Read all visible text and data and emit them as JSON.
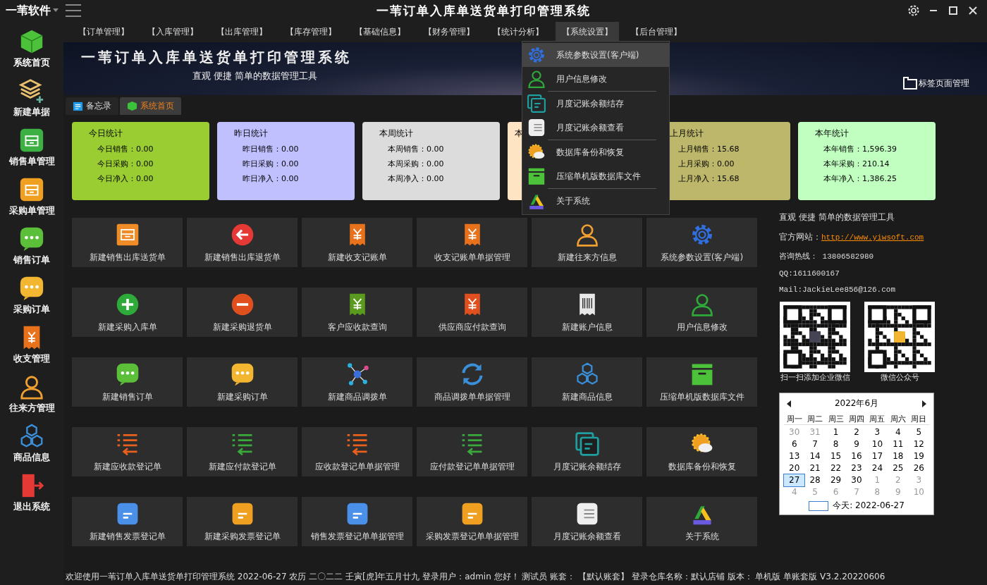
{
  "app_name": "一苇软件",
  "window": {
    "title": "一苇订单入库单送货单打印管理系统"
  },
  "sidebar": {
    "items": [
      {
        "label": "系统首页",
        "selected": true
      },
      {
        "label": "新建单据",
        "selected": false
      },
      {
        "label": "销售单管理",
        "selected": false
      },
      {
        "label": "采购单管理",
        "selected": false
      },
      {
        "label": "销售订单",
        "selected": false
      },
      {
        "label": "采购订单",
        "selected": false
      },
      {
        "label": "收支管理",
        "selected": false
      },
      {
        "label": "往来方管理",
        "selected": false
      },
      {
        "label": "商品信息",
        "selected": false
      },
      {
        "label": "退出系统",
        "selected": false
      }
    ]
  },
  "menu_bar": [
    {
      "label": "【订单管理】",
      "selected": false
    },
    {
      "label": "【入库管理】",
      "selected": false
    },
    {
      "label": "【出库管理】",
      "selected": false
    },
    {
      "label": "【库存管理】",
      "selected": false
    },
    {
      "label": "【基础信息】",
      "selected": false
    },
    {
      "label": "【财务管理】",
      "selected": false
    },
    {
      "label": "【统计分析】",
      "selected": false
    },
    {
      "label": "【系统设置】",
      "selected": true
    },
    {
      "label": "【后台管理】",
      "selected": false
    }
  ],
  "dropdown": [
    {
      "label": "系统参数设置(客户端)",
      "selected": true,
      "divider_before": false
    },
    {
      "label": "用户信息修改",
      "selected": false,
      "divider_before": false
    },
    {
      "label": "月度记账余额结存",
      "selected": false,
      "divider_before": true
    },
    {
      "label": "月度记账余额查看",
      "selected": false,
      "divider_before": false
    },
    {
      "label": "数据库备份和恢复",
      "selected": false,
      "divider_before": true
    },
    {
      "label": "压缩单机版数据库文件",
      "selected": false,
      "divider_before": false
    },
    {
      "label": "关于系统",
      "selected": false,
      "divider_before": true
    }
  ],
  "banner": {
    "title": "一苇订单入库单送货单打印管理系统",
    "subtitle": "直观 便捷 简单的数据管理工具",
    "tab_manager": "标签页面管理"
  },
  "tabs": [
    {
      "label": "备忘录",
      "selected": false
    },
    {
      "label": "系统首页",
      "selected": true
    }
  ],
  "stat_cards": [
    {
      "title": "今日统计",
      "color": "#9acd32",
      "rows": [
        "今日销售：0.00",
        "今日采购：0.00",
        "今日净入：0.00"
      ]
    },
    {
      "title": "昨日统计",
      "color": "#c0c0ff",
      "rows": [
        "昨日销售：0.00",
        "昨日采购：0.00",
        "昨日净入：0.00"
      ]
    },
    {
      "title": "本周统计",
      "color": "#dcdcdc",
      "rows": [
        "本周销售：0.00",
        "本周采购：0.00",
        "本周净入：0.00"
      ]
    },
    {
      "title": "本",
      "color": "#ffe4c4"
    },
    {
      "title": "上月统计",
      "color": "#bdb76b",
      "rows": [
        "上月销售：15.68",
        "上月采购：0.00",
        "上月净入：15.68"
      ]
    },
    {
      "title": "本年统计",
      "color": "#c0ffc0",
      "rows": [
        "本年销售：1,596.39",
        "本年采购：210.14",
        "本年净入：1,386.25"
      ]
    }
  ],
  "tiles": [
    "新建销售出库送货单",
    "新建销售出库退货单",
    "新建收支记账单",
    "收支记账单单据管理",
    "新建往来方信息",
    "系统参数设置(客户端)",
    "新建采购入库单",
    "新建采购退货单",
    "客户应收款查询",
    "供应商应付款查询",
    "新建账户信息",
    "用户信息修改",
    "新建销售订单",
    "新建采购订单",
    "新建商品调拨单",
    "商品调拨单单据管理",
    "新建商品信息",
    "压缩单机版数据库文件",
    "新建应收款登记单",
    "新建应付款登记单",
    "应收款登记单单据管理",
    "应付款登记单单据管理",
    "月度记账余额结存",
    "数据库备份和恢复",
    "新建销售发票登记单",
    "新建采购发票登记单",
    "销售发票登记单单据管理",
    "采购发票登记单单据管理",
    "月度记账余额查看",
    "关于系统"
  ],
  "info": {
    "slogan": "直观 便捷 简单的数据管理工具",
    "website_label": "官方网站：",
    "website": "http://www.yiwsoft.com",
    "hotline": "咨询热线： 13806582980",
    "qq": "QQ:1611600167",
    "mail": "Mail:JackieLee856@126.com",
    "qr_captions": [
      "扫一扫添加企业微信",
      "微信公众号"
    ]
  },
  "calendar": {
    "title": "2022年6月",
    "weekdays": [
      "周一",
      "周二",
      "周三",
      "周四",
      "周五",
      "周六",
      "周日"
    ],
    "weeks": [
      [
        {
          "d": "30",
          "other": true,
          "selected": false
        },
        {
          "d": "31",
          "other": true,
          "selected": false
        },
        {
          "d": "1",
          "other": false,
          "selected": false
        },
        {
          "d": "2",
          "other": false,
          "selected": false
        },
        {
          "d": "3",
          "other": false,
          "selected": false
        },
        {
          "d": "4",
          "other": false,
          "selected": false
        },
        {
          "d": "5",
          "other": false,
          "selected": false
        }
      ],
      [
        {
          "d": "6",
          "other": false,
          "selected": false
        },
        {
          "d": "7",
          "other": false,
          "selected": false
        },
        {
          "d": "8",
          "other": false,
          "selected": false
        },
        {
          "d": "9",
          "other": false,
          "selected": false
        },
        {
          "d": "10",
          "other": false,
          "selected": false
        },
        {
          "d": "11",
          "other": false,
          "selected": false
        },
        {
          "d": "12",
          "other": false,
          "selected": false
        }
      ],
      [
        {
          "d": "13",
          "other": false,
          "selected": false
        },
        {
          "d": "14",
          "other": false,
          "selected": false
        },
        {
          "d": "15",
          "other": false,
          "selected": false
        },
        {
          "d": "16",
          "other": false,
          "selected": false
        },
        {
          "d": "17",
          "other": false,
          "selected": false
        },
        {
          "d": "18",
          "other": false,
          "selected": false
        },
        {
          "d": "19",
          "other": false,
          "selected": false
        }
      ],
      [
        {
          "d": "20",
          "other": false,
          "selected": false
        },
        {
          "d": "21",
          "other": false,
          "selected": false
        },
        {
          "d": "22",
          "other": false,
          "selected": false
        },
        {
          "d": "23",
          "other": false,
          "selected": false
        },
        {
          "d": "24",
          "other": false,
          "selected": false
        },
        {
          "d": "25",
          "other": false,
          "selected": false
        },
        {
          "d": "26",
          "other": false,
          "selected": false
        }
      ],
      [
        {
          "d": "27",
          "other": false,
          "selected": true
        },
        {
          "d": "28",
          "other": false,
          "selected": false
        },
        {
          "d": "29",
          "other": false,
          "selected": false
        },
        {
          "d": "30",
          "other": false,
          "selected": false
        },
        {
          "d": "1",
          "other": true,
          "selected": false
        },
        {
          "d": "2",
          "other": true,
          "selected": false
        },
        {
          "d": "3",
          "other": true,
          "selected": false
        }
      ],
      [
        {
          "d": "4",
          "other": true,
          "selected": false
        },
        {
          "d": "5",
          "other": true,
          "selected": false
        },
        {
          "d": "6",
          "other": true,
          "selected": false
        },
        {
          "d": "7",
          "other": true,
          "selected": false
        },
        {
          "d": "8",
          "other": true,
          "selected": false
        },
        {
          "d": "9",
          "other": true,
          "selected": false
        },
        {
          "d": "10",
          "other": true,
          "selected": false
        }
      ]
    ],
    "today": "今天: 2022-06-27"
  },
  "status_bar": "欢迎使用一苇订单入库单送货单打印管理系统 2022-06-27 农历 二〇二二 壬寅[虎]年五月廿九 登录用户：admin 您好！ 测试员 账套： 【默认账套】 登录仓库名称：默认店铺 版本： 单机版 单账套版 V3.2.20220606"
}
